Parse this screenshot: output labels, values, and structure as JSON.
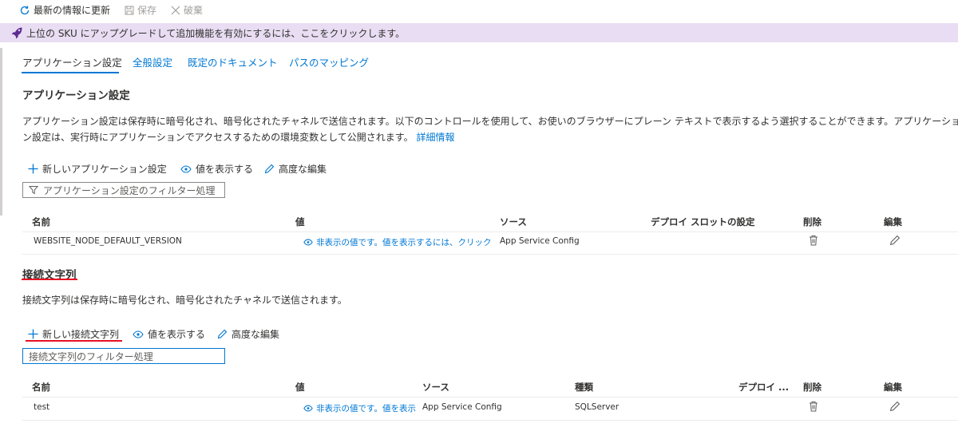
{
  "toolbar": {
    "refresh_label": "最新の情報に更新",
    "save_label": "保存",
    "discard_label": "破棄"
  },
  "banner": {
    "text": "上位の SKU にアップグレードして追加機能を有効にするには、ここをクリックします。"
  },
  "tabs": [
    {
      "label": "アプリケーション設定"
    },
    {
      "label": "全般設定"
    },
    {
      "label": "既定のドキュメント"
    },
    {
      "label": "パスのマッピング"
    }
  ],
  "app_settings": {
    "title": "アプリケーション設定",
    "description_line1": "アプリケーション設定は保存時に暗号化され、暗号化されたチャネルで送信されます。以下のコントロールを使用して、お使いのブラウザーにプレーン テキストで表示するよう選択することができます。アプリケーショ",
    "description_line2": "ン設定は、実行時にアプリケーションでアクセスするための環境変数として公開されます。",
    "learn_more": "詳細情報",
    "new_label": "新しいアプリケーション設定",
    "show_values_label": "値を表示する",
    "advanced_edit_label": "高度な編集",
    "filter_placeholder": "アプリケーション設定のフィルター処理",
    "columns": {
      "name": "名前",
      "value": "値",
      "source": "ソース",
      "slot": "デプロイ スロットの設定",
      "delete": "削除",
      "edit": "編集"
    },
    "rows": [
      {
        "name": "WEBSITE_NODE_DEFAULT_VERSION",
        "value": "非表示の値です。値を表示するには、クリックし",
        "source": "App Service Config"
      }
    ]
  },
  "connection_strings": {
    "title": "接続文字列",
    "description": "接続文字列は保存時に暗号化され、暗号化されたチャネルで送信されます。",
    "new_label": "新しい接続文字列",
    "show_values_label": "値を表示する",
    "advanced_edit_label": "高度な編集",
    "filter_placeholder": "接続文字列のフィルター処理",
    "columns": {
      "name": "名前",
      "value": "値",
      "source": "ソース",
      "type": "種類",
      "slot": "デプロイ ...",
      "delete": "削除",
      "edit": "編集"
    },
    "rows": [
      {
        "name": "test",
        "value": "非表示の値です。値を表示",
        "source": "App Service Config",
        "type": "SQLServer"
      }
    ]
  },
  "colors": {
    "accent": "#0078d4",
    "banner_bg": "#e8ddf2",
    "rocket": "#5c2d91",
    "annotation_red": "#e81123"
  }
}
